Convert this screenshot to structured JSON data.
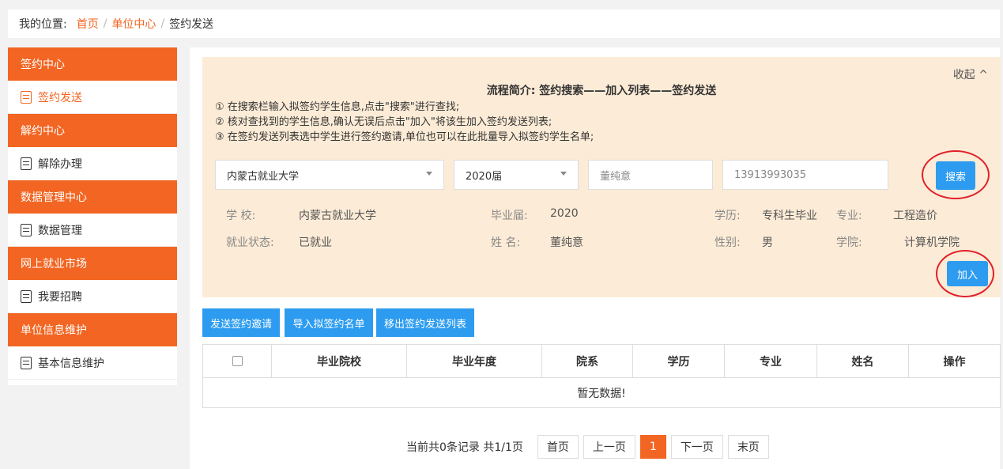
{
  "breadcrumb": {
    "label": "我的位置:",
    "home": "首页",
    "sep": "/",
    "center": "单位中心",
    "current": "签约发送"
  },
  "sidebar": {
    "groups": [
      {
        "title": "签约中心",
        "item": "签约发送",
        "active": true
      },
      {
        "title": "解约中心",
        "item": "解除办理"
      },
      {
        "title": "数据管理中心",
        "item": "数据管理"
      },
      {
        "title": "网上就业市场",
        "item": "我要招聘"
      },
      {
        "title": "单位信息维护",
        "item": "基本信息维护"
      }
    ]
  },
  "panel": {
    "collapse": "收起 ^",
    "flow_title": "流程简介: 签约搜索——加入列表——签约发送",
    "steps": [
      "① 在搜索栏输入拟签约学生信息,点击\"搜索\"进行查找;",
      "② 核对查找到的学生信息,确认无误后点击\"加入\"将该生加入签约发送列表;",
      "③ 在签约发送列表选中学生进行签约邀请,单位也可以在此批量导入拟签约学生名单;"
    ],
    "school_select": "内蒙古就业大学",
    "year_select": "2020届",
    "name_input": "董纯意",
    "id_input": "13913993035",
    "search_btn": "搜索",
    "add_btn": "加入",
    "info": {
      "school_label": "学    校:",
      "school": "内蒙古就业大学",
      "gradyear_label": "毕业届:",
      "gradyear": "2020",
      "edu_label": "学历:",
      "edu": "专科生毕业",
      "major_label": "专业:",
      "major": "工程造价",
      "status_label": "就业状态:",
      "status": "已就业",
      "name_label": "姓    名:",
      "name": "董纯意",
      "gender_label": "性别:",
      "gender": "男",
      "college_label": "学院:",
      "college": "计算机学院"
    }
  },
  "toolbar": {
    "send": "发送签约邀请",
    "import": "导入拟签约名单",
    "remove": "移出签约发送列表"
  },
  "table": {
    "headers": [
      "毕业院校",
      "毕业年度",
      "院系",
      "学历",
      "专业",
      "姓名",
      "操作"
    ],
    "empty": "暂无数据!"
  },
  "pager": {
    "summary": "当前共0条记录  共1/1页",
    "first": "首页",
    "prev": "上一页",
    "page": "1",
    "next": "下一页",
    "last": "末页"
  },
  "colors": {
    "accent": "#f26522",
    "blue": "#2d9cf0",
    "panel_bg": "#fcebd6",
    "highlight_circle": "#e0202a"
  }
}
